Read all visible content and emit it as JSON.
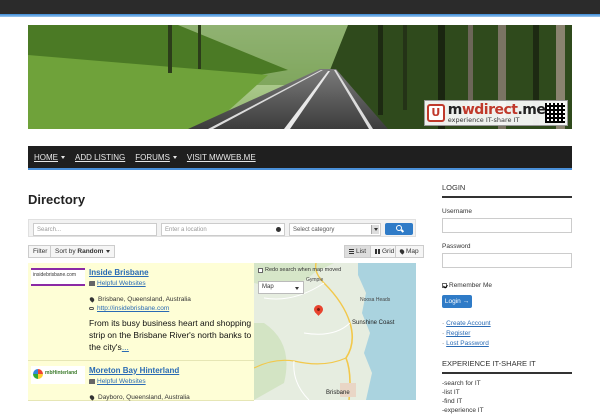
{
  "brand": {
    "logo_name_1": "m",
    "logo_name_2": "wdirect",
    "logo_name_3": ".me",
    "logo_tagline": "experience IT-share IT",
    "logo_mark": "U"
  },
  "nav": {
    "items": [
      {
        "label": "HOME",
        "dropdown": true
      },
      {
        "label": "ADD LISTING",
        "dropdown": false
      },
      {
        "label": "FORUMS",
        "dropdown": true
      },
      {
        "label": "VISIT MWWEB.ME",
        "dropdown": false
      }
    ]
  },
  "page_title": "Directory",
  "search": {
    "keyword_placeholder": "Search...",
    "location_placeholder": "Enter a location",
    "category_placeholder": "Select category"
  },
  "toolbar": {
    "filter_label": "Filter",
    "sort_prefix": "Sort by ",
    "sort_value": "Random",
    "view_list": "List",
    "view_grid": "Grid",
    "view_map": "Map"
  },
  "listings": [
    {
      "thumb_text": "insidebrisbane.com",
      "title": "Inside Brisbane",
      "category": "Helpful Websites",
      "address": "Brisbane, Queensland, Australia",
      "url": "http://insidebrisbane.com",
      "description": "From its busy business heart and shopping strip on the Brisbane River's north banks to the city's",
      "more": "..."
    },
    {
      "thumb_text": "mbHinterland",
      "title": "Moreton Bay Hinterland",
      "category": "Helpful Websites",
      "address": "Dayboro, Queensland, Australia"
    }
  ],
  "map": {
    "redo_label": "Redo search when map moved",
    "type_label": "Map",
    "labels": {
      "gympie": "Gympie",
      "noosa": "Noosa Heads",
      "sunshine": "Sunshine Coast",
      "brisbane": "Brisbane"
    }
  },
  "sidebar": {
    "login_heading": "LOGIN",
    "username_label": "Username",
    "password_label": "Password",
    "remember_label": "Remember Me",
    "login_button": "Login →",
    "links": [
      "Create Account",
      "Register",
      "Lost Password"
    ],
    "section2_heading": "EXPERIENCE IT-SHARE IT",
    "section2_items": [
      "-search for IT",
      "-list IT",
      "-find IT",
      "-experience IT"
    ]
  },
  "colors": {
    "accent": "#2f7bc7",
    "nav_bg": "#1f1f1f",
    "listing_bg": "#fefed6",
    "logo_red": "#c0392b"
  }
}
